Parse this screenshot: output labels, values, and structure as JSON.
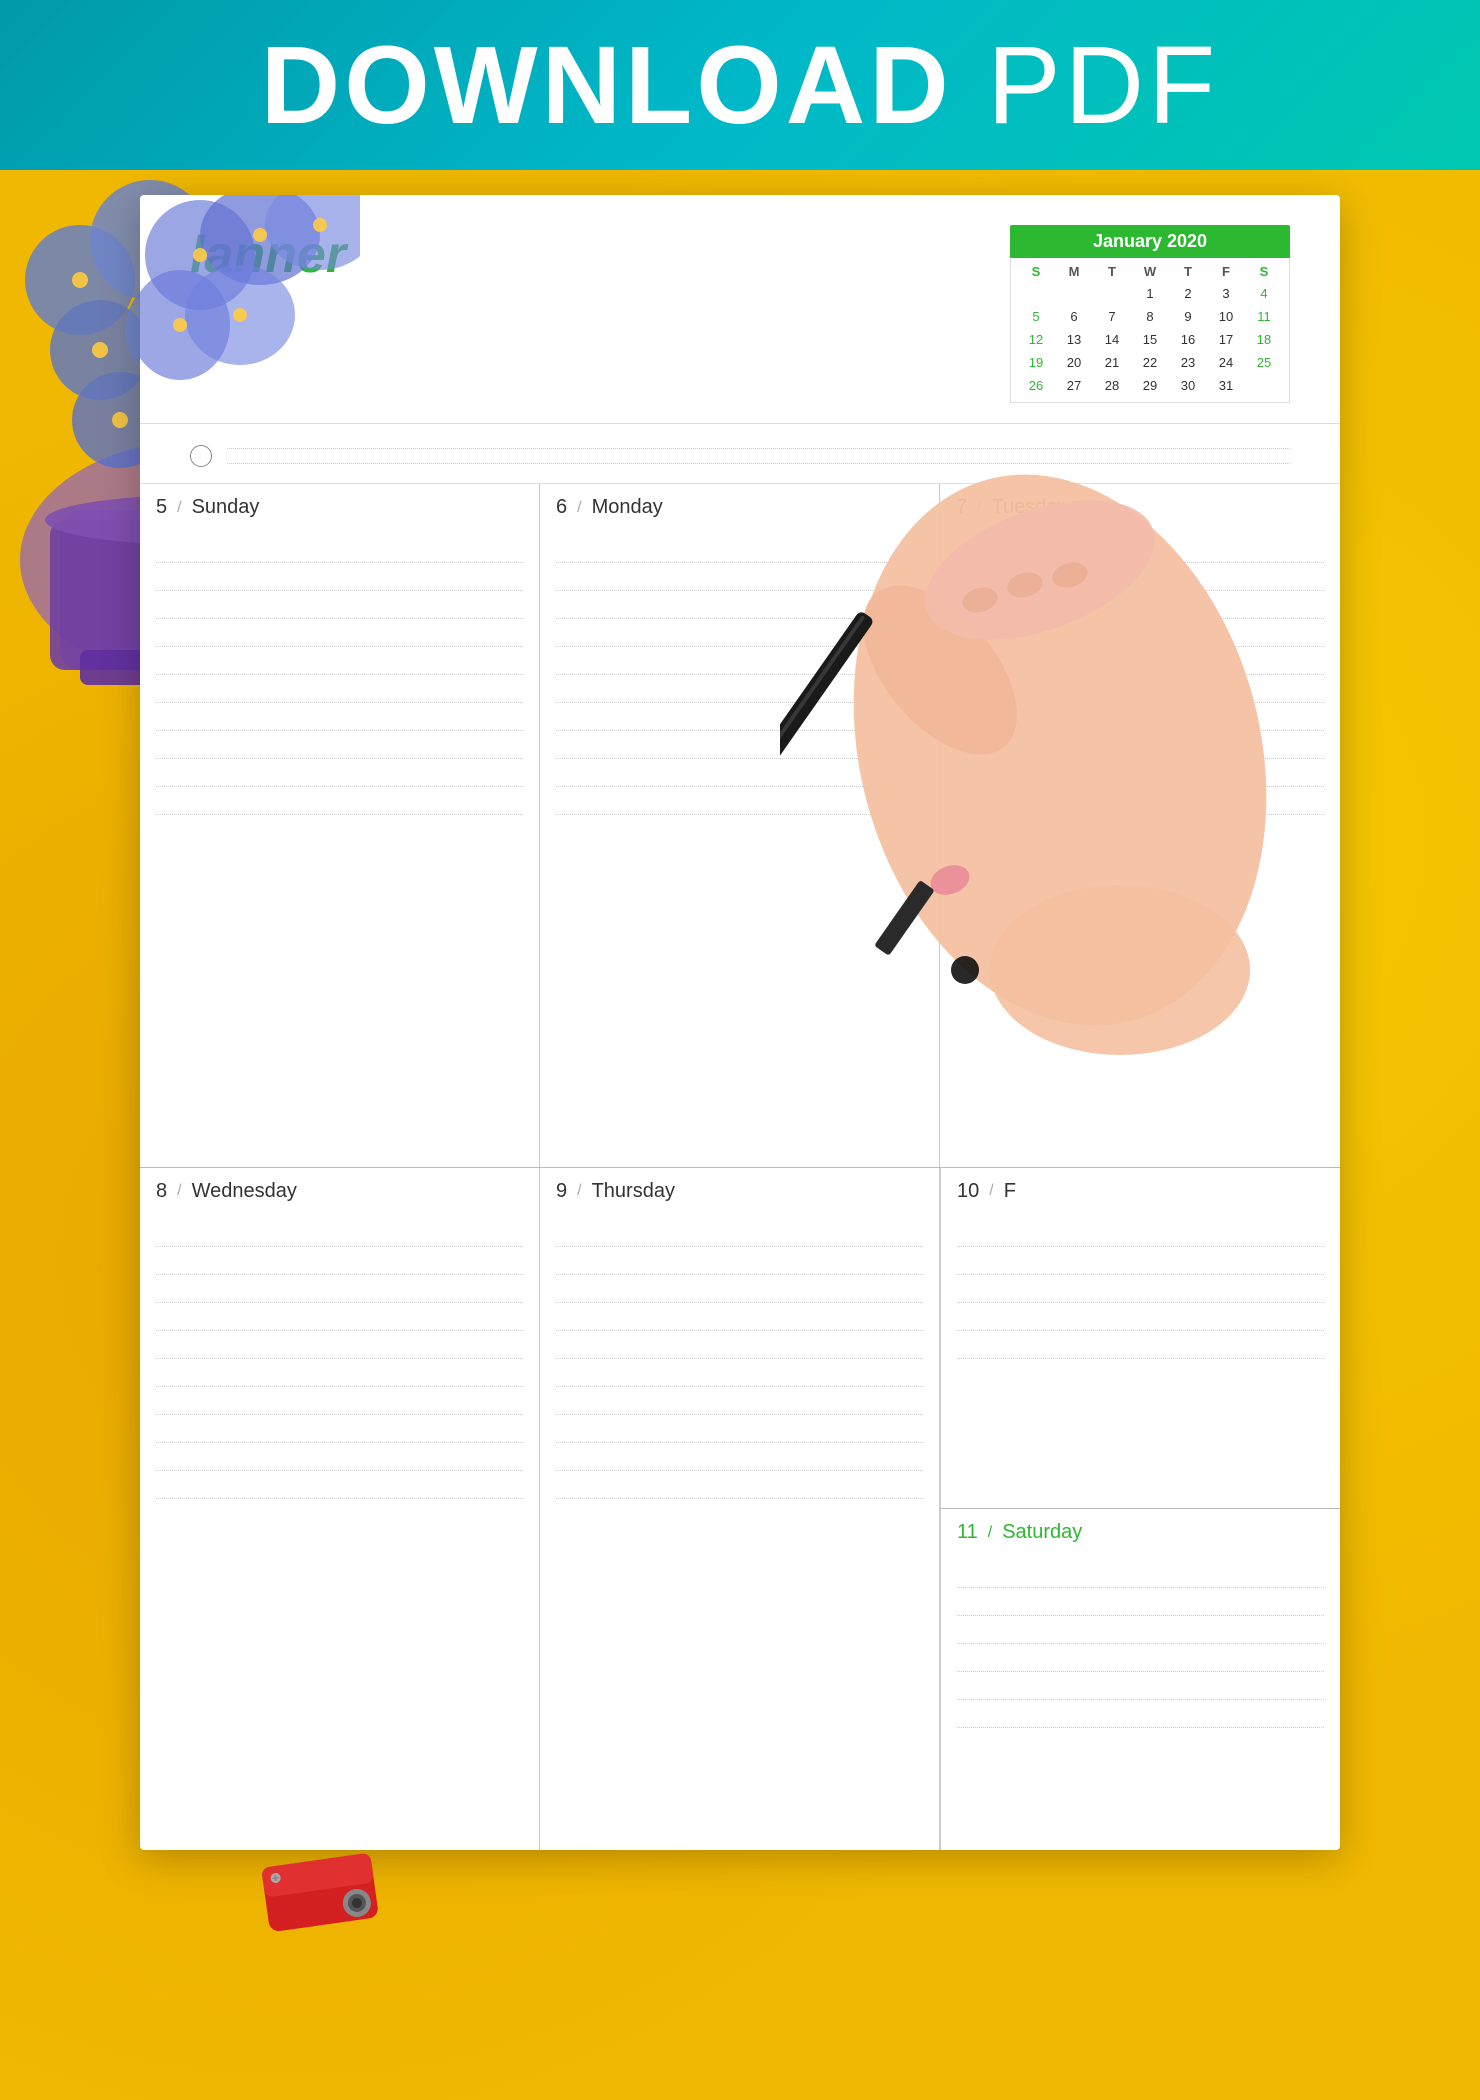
{
  "header": {
    "title_bold": "DOWNLOAD",
    "title_light": " PDF",
    "bg_color": "#009aaa"
  },
  "planner": {
    "title": "lanner",
    "calendar": {
      "month_year": "January 2020",
      "days_header": [
        "S",
        "M",
        "T",
        "W",
        "T",
        "F",
        "S"
      ],
      "weeks": [
        [
          "",
          "",
          "",
          "1",
          "2",
          "3",
          "4"
        ],
        [
          "5",
          "6",
          "7",
          "8",
          "9",
          "10",
          "11"
        ],
        [
          "12",
          "13",
          "14",
          "15",
          "16",
          "17",
          "18"
        ],
        [
          "19",
          "20",
          "21",
          "22",
          "23",
          "24",
          "25"
        ],
        [
          "26",
          "27",
          "28",
          "29",
          "30",
          "31",
          ""
        ]
      ]
    },
    "week_row_1": [
      {
        "number": "5",
        "name": "Sunday",
        "special": false
      },
      {
        "number": "6",
        "name": "Monday",
        "special": false
      },
      {
        "number": "7",
        "name": "Tuesday",
        "special": false
      }
    ],
    "week_row_2": [
      {
        "number": "8",
        "name": "Wednesday",
        "special": false
      },
      {
        "number": "9",
        "name": "Thursday",
        "special": false
      },
      {
        "number": "10",
        "name": "Friday",
        "special": false
      }
    ],
    "saturday": {
      "number": "11",
      "name": "Saturday",
      "special": true
    },
    "line_count_row1": 10,
    "line_count_row2": 10,
    "line_count_saturday": 6
  }
}
